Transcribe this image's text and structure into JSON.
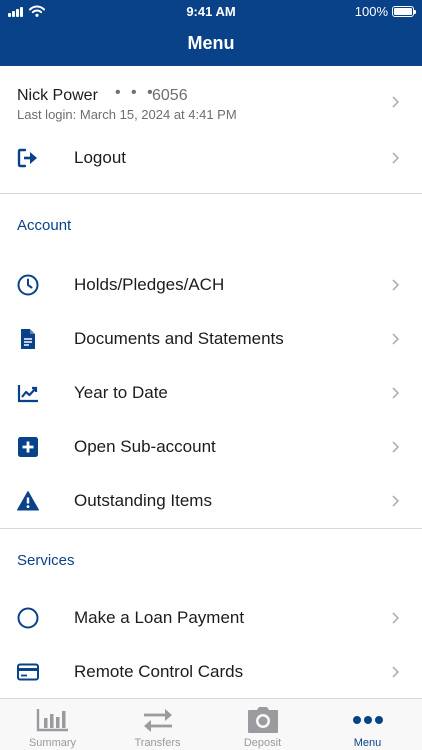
{
  "status_bar": {
    "time": "9:41 AM",
    "battery": "100%"
  },
  "header": {
    "title": "Menu"
  },
  "user": {
    "name": "Nick Power",
    "masked": "• • •",
    "account_suffix": "6056",
    "last_login": "Last login: March 15, 2024 at 4:41 PM"
  },
  "logout": {
    "label": "Logout",
    "icon": "logout-icon"
  },
  "sections": {
    "account": {
      "title": "Account",
      "items": [
        {
          "label": "Holds/Pledges/ACH",
          "icon": "clock-icon"
        },
        {
          "label": "Documents and Statements",
          "icon": "document-icon"
        },
        {
          "label": "Year to Date",
          "icon": "chart-icon"
        },
        {
          "label": "Open Sub-account",
          "icon": "plus-icon"
        },
        {
          "label": "Outstanding Items",
          "icon": "warning-icon"
        }
      ]
    },
    "services": {
      "title": "Services",
      "items": [
        {
          "label": "Make a Loan Payment",
          "icon": "circle-icon"
        },
        {
          "label": "Remote Control Cards",
          "icon": "card-icon"
        }
      ]
    }
  },
  "tabbar": {
    "tabs": [
      {
        "label": "Summary",
        "icon": "bar-chart-icon",
        "active": false
      },
      {
        "label": "Transfers",
        "icon": "transfer-icon",
        "active": false
      },
      {
        "label": "Deposit",
        "icon": "camera-icon",
        "active": false
      },
      {
        "label": "Menu",
        "icon": "more-icon",
        "active": true
      }
    ]
  },
  "colors": {
    "brand": "#0a4289",
    "muted": "#6e6e73",
    "inactive_tab": "#9a9a9f",
    "divider": "#d8d8dc"
  }
}
